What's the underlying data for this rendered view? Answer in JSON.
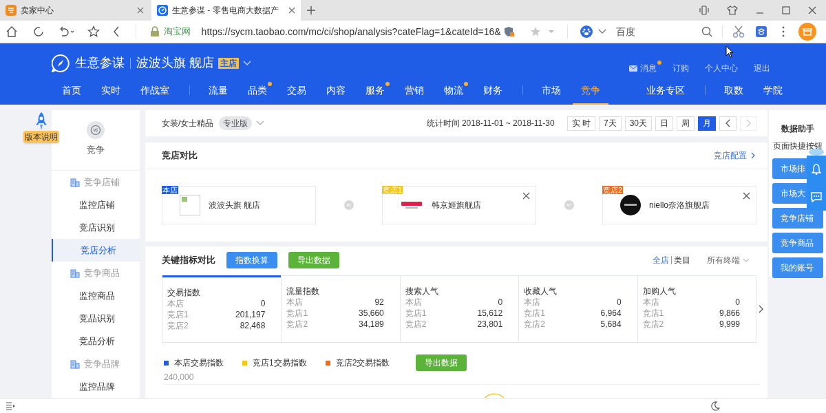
{
  "browser_tabs": [
    {
      "title": "卖家中心",
      "selected": false
    },
    {
      "title": "生意参谋 - 零售电商大数据产",
      "selected": true
    }
  ],
  "address_bar": {
    "site_label": "淘宝网",
    "url": "https://sycm.taobao.com/mc/ci/shop/analysis?cateFlag=1&cateId=16&",
    "search_engine": "百度"
  },
  "header": {
    "product": "生意参谋",
    "shop": "波波头旗 舰店",
    "shop_badge": "主店",
    "links": [
      {
        "label": "消息",
        "dot": true
      },
      {
        "label": "订购",
        "dot": false
      },
      {
        "label": "个人中心",
        "dot": false
      },
      {
        "label": "退出",
        "dot": false
      }
    ],
    "nav": [
      {
        "kind": "link",
        "label": "首页",
        "dot": false,
        "selected": false
      },
      {
        "kind": "link",
        "label": "实时",
        "dot": false,
        "selected": false
      },
      {
        "kind": "link",
        "label": "作战室",
        "dot": false,
        "selected": false
      },
      {
        "kind": "divider"
      },
      {
        "kind": "link",
        "label": "流量",
        "dot": false,
        "selected": false
      },
      {
        "kind": "link",
        "label": "品类",
        "dot": true,
        "selected": false
      },
      {
        "kind": "link",
        "label": "交易",
        "dot": false,
        "selected": false
      },
      {
        "kind": "link",
        "label": "内容",
        "dot": false,
        "selected": false
      },
      {
        "kind": "link",
        "label": "服务",
        "dot": true,
        "selected": false
      },
      {
        "kind": "link",
        "label": "营销",
        "dot": false,
        "selected": false
      },
      {
        "kind": "link",
        "label": "物流",
        "dot": true,
        "selected": false
      },
      {
        "kind": "link",
        "label": "财务",
        "dot": false,
        "selected": false
      },
      {
        "kind": "divider"
      },
      {
        "kind": "link",
        "label": "市场",
        "dot": false,
        "selected": false
      },
      {
        "kind": "link",
        "label": "竞争",
        "dot": false,
        "selected": true
      },
      {
        "kind": "spacer"
      },
      {
        "kind": "link",
        "label": "业务专区",
        "dot": false,
        "selected": false
      },
      {
        "kind": "divider"
      },
      {
        "kind": "link",
        "label": "取数",
        "dot": false,
        "selected": false
      },
      {
        "kind": "link",
        "label": "学院",
        "dot": false,
        "selected": false
      }
    ]
  },
  "version_note": "版本说明",
  "sidebar": {
    "title": "竞争",
    "groups": [
      {
        "label": "竞争店铺",
        "children": [
          {
            "label": "监控店铺",
            "selected": false
          },
          {
            "label": "竞店识别",
            "selected": false
          },
          {
            "label": "竞店分析",
            "selected": true
          }
        ]
      },
      {
        "label": "竞争商品",
        "children": [
          {
            "label": "监控商品",
            "selected": false
          },
          {
            "label": "竞品识别",
            "selected": false
          },
          {
            "label": "竞品分析",
            "selected": false
          }
        ]
      },
      {
        "label": "竞争品牌",
        "children": [
          {
            "label": "监控品牌",
            "selected": false
          }
        ]
      }
    ]
  },
  "filter_bar": {
    "category": "女装/女士精品",
    "edition": "专业版",
    "period": "统计时间 2018-11-01 ~ 2018-11-30",
    "ranges": [
      {
        "label": "实 时",
        "selected": false
      },
      {
        "label": "7天",
        "selected": false
      },
      {
        "label": "30天",
        "selected": false
      },
      {
        "label": "日",
        "selected": false
      },
      {
        "label": "周",
        "selected": false
      },
      {
        "label": "月",
        "selected": true
      }
    ],
    "prev_disabled": false,
    "next_disabled": true
  },
  "store_compare": {
    "title": "竞店对比",
    "config_link": "竞店配置",
    "stores": [
      {
        "tag": "本店",
        "color": "#1d5ce6",
        "name": "波波头旗 舰店",
        "removable": false,
        "kind": "placeholder"
      },
      {
        "tag": "竞店1",
        "color": "#f5c518",
        "name": "韩京姬旗舰店",
        "removable": true,
        "kind": "red-mark"
      },
      {
        "tag": "竞店2",
        "color": "#f06a1c",
        "name": "niello奈洛旗舰店",
        "removable": true,
        "kind": "dark-circle"
      }
    ]
  },
  "key_metrics": {
    "title": "关键指标对比",
    "convert_button": "指数换算",
    "export_button": "导出数据",
    "scope": [
      {
        "label": "全店",
        "selected": true
      },
      {
        "label": "类目",
        "selected": false
      }
    ],
    "terminal": "所有终端",
    "cards": [
      {
        "title": "交易指数",
        "selected": true,
        "rows": [
          {
            "label": "本店",
            "value": "0"
          },
          {
            "label": "竞店1",
            "value": "201,197"
          },
          {
            "label": "竞店2",
            "value": "82,468"
          }
        ]
      },
      {
        "title": "流量指数",
        "selected": false,
        "rows": [
          {
            "label": "本店",
            "value": "92"
          },
          {
            "label": "竞店1",
            "value": "35,660"
          },
          {
            "label": "竞店2",
            "value": "34,189"
          }
        ]
      },
      {
        "title": "搜索人气",
        "selected": false,
        "rows": [
          {
            "label": "本店",
            "value": "0"
          },
          {
            "label": "竞店1",
            "value": "15,612"
          },
          {
            "label": "竞店2",
            "value": "23,801"
          }
        ]
      },
      {
        "title": "收藏人气",
        "selected": false,
        "rows": [
          {
            "label": "本店",
            "value": "0"
          },
          {
            "label": "竞店1",
            "value": "6,964"
          },
          {
            "label": "竞店2",
            "value": "5,684"
          }
        ]
      },
      {
        "title": "加购人气",
        "selected": false,
        "rows": [
          {
            "label": "本店",
            "value": "0"
          },
          {
            "label": "竞店1",
            "value": "9,866"
          },
          {
            "label": "竞店2",
            "value": "9,999"
          }
        ]
      }
    ],
    "legend": [
      {
        "label": "本店交易指数",
        "color": "#2a5bd7"
      },
      {
        "label": "竞店1交易指数",
        "color": "#f5c518"
      },
      {
        "label": "竞店2交易指数",
        "color": "#f06a1c"
      }
    ],
    "chart_export_button": "导出数据",
    "y_tick": "240,000"
  },
  "assistant": {
    "title": "数据助手",
    "subtitle": "页面快捷按钮",
    "buttons": [
      "市场排",
      "市场大",
      "竞争店铺",
      "竞争商品",
      "我的账号"
    ]
  }
}
